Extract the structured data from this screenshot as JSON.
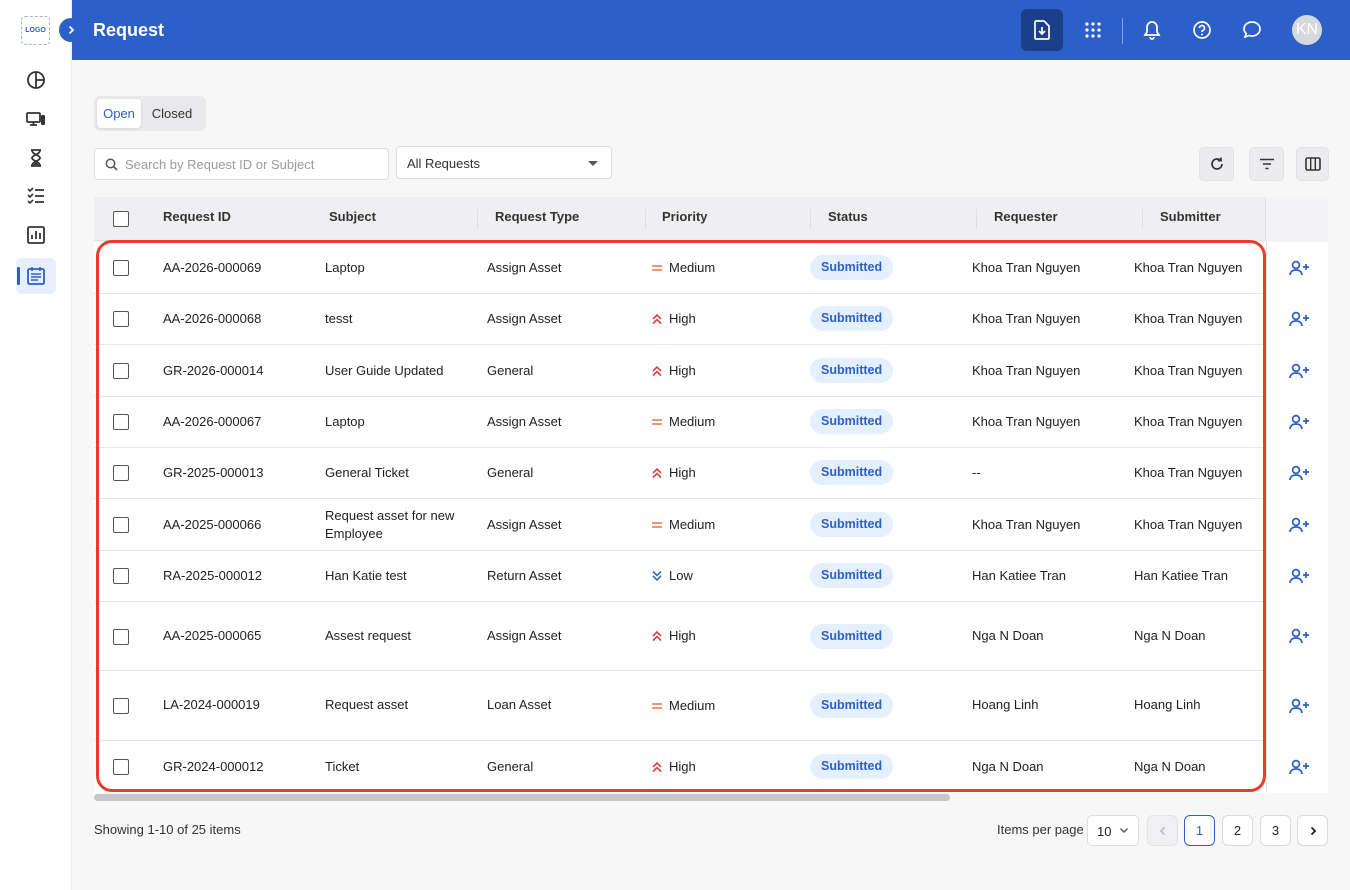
{
  "sidebar": {
    "logo": "LOGO",
    "items": [
      {
        "name": "dashboard",
        "icon": "pie-chart-icon"
      },
      {
        "name": "assets",
        "icon": "devices-icon"
      },
      {
        "name": "hourglass",
        "icon": "hourglass-icon"
      },
      {
        "name": "checklist",
        "icon": "checklist-icon"
      },
      {
        "name": "reports",
        "icon": "bar-chart-icon"
      },
      {
        "name": "requests",
        "icon": "request-list-icon",
        "active": true
      }
    ]
  },
  "header": {
    "title": "Request",
    "avatar_initials": "KN"
  },
  "tabs": [
    {
      "label": "Open",
      "active": true
    },
    {
      "label": "Closed",
      "active": false
    }
  ],
  "filters": {
    "search_placeholder": "Search by Request ID or Subject",
    "search_value": "",
    "request_filter": "All Requests"
  },
  "table": {
    "columns": [
      "Request ID",
      "Subject",
      "Request Type",
      "Priority",
      "Status",
      "Requester",
      "Submitter"
    ],
    "rows": [
      {
        "id": "AA-2026-000069",
        "subject": "Laptop",
        "type": "Assign Asset",
        "priority": "Medium",
        "status": "Submitted",
        "requester": "Khoa Tran Nguyen",
        "submitter": "Khoa Tran Nguyen"
      },
      {
        "id": "AA-2026-000068",
        "subject": "tesst",
        "type": "Assign Asset",
        "priority": "High",
        "status": "Submitted",
        "requester": "Khoa Tran Nguyen",
        "submitter": "Khoa Tran Nguyen"
      },
      {
        "id": "GR-2026-000014",
        "subject": "User Guide Updated",
        "type": "General",
        "priority": "High",
        "status": "Submitted",
        "requester": "Khoa Tran Nguyen",
        "submitter": "Khoa Tran Nguyen"
      },
      {
        "id": "AA-2026-000067",
        "subject": "Laptop",
        "type": "Assign Asset",
        "priority": "Medium",
        "status": "Submitted",
        "requester": "Khoa Tran Nguyen",
        "submitter": "Khoa Tran Nguyen"
      },
      {
        "id": "GR-2025-000013",
        "subject": "General Ticket",
        "type": "General",
        "priority": "High",
        "status": "Submitted",
        "requester": "--",
        "submitter": "Khoa Tran Nguyen"
      },
      {
        "id": "AA-2025-000066",
        "subject": "Request asset for new Employee",
        "type": "Assign Asset",
        "priority": "Medium",
        "status": "Submitted",
        "requester": "Khoa Tran Nguyen",
        "submitter": "Khoa Tran Nguyen"
      },
      {
        "id": "RA-2025-000012",
        "subject": "Han Katie test",
        "type": "Return Asset",
        "priority": "Low",
        "status": "Submitted",
        "requester": "Han Katiee Tran",
        "submitter": "Han Katiee Tran"
      },
      {
        "id": "AA-2025-000065",
        "subject": "Assest request",
        "type": "Assign Asset",
        "priority": "High",
        "status": "Submitted",
        "requester": "Nga N Doan",
        "submitter": "Nga N Doan"
      },
      {
        "id": "LA-2024-000019",
        "subject": "Request asset",
        "type": "Loan Asset",
        "priority": "Medium",
        "status": "Submitted",
        "requester": "Hoang Linh",
        "submitter": "Hoang Linh"
      },
      {
        "id": "GR-2024-000012",
        "subject": "Ticket",
        "type": "General",
        "priority": "High",
        "status": "Submitted",
        "requester": "Nga N Doan",
        "submitter": "Nga N Doan"
      }
    ]
  },
  "colors": {
    "primary": "#2c5fc7",
    "priority_medium": "#e8744a",
    "priority_high": "#d9443c",
    "priority_low": "#2c6fc7",
    "highlight": "#e53e2e"
  },
  "footer": {
    "showing": "Showing 1-10 of 25 items",
    "items_per_page_label": "Items per page",
    "items_per_page": "10",
    "pages": [
      "1",
      "2",
      "3"
    ],
    "current_page": "1"
  }
}
